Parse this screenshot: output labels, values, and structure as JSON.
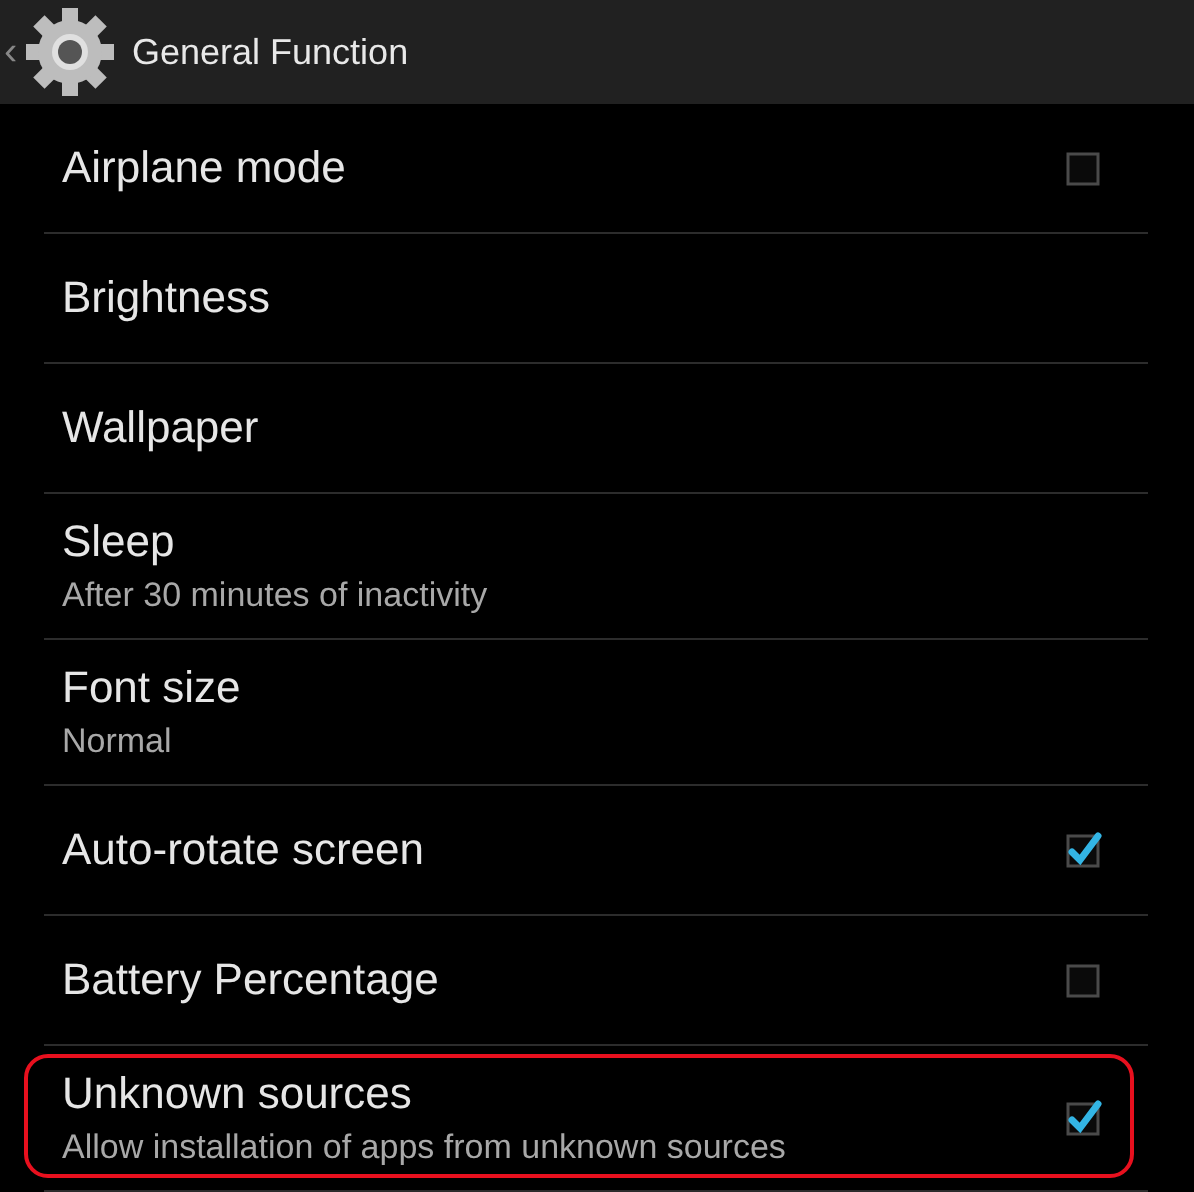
{
  "header": {
    "back": "‹",
    "title": "General Function"
  },
  "settings": [
    {
      "title": "Airplane mode",
      "kind": "checkbox",
      "checked": false,
      "highlighted": false
    },
    {
      "title": "Brightness",
      "kind": "plain",
      "highlighted": false
    },
    {
      "title": "Wallpaper",
      "kind": "plain",
      "highlighted": false
    },
    {
      "title": "Sleep",
      "summary": "After 30 minutes of inactivity",
      "kind": "plain",
      "highlighted": false
    },
    {
      "title": "Font size",
      "summary": "Normal",
      "kind": "plain",
      "highlighted": false
    },
    {
      "title": "Auto-rotate screen",
      "kind": "checkbox",
      "checked": true,
      "highlighted": false
    },
    {
      "title": "Battery Percentage",
      "kind": "checkbox",
      "checked": false,
      "highlighted": false
    },
    {
      "title": "Unknown sources",
      "summary": "Allow installation of apps from unknown sources",
      "kind": "checkbox",
      "checked": true,
      "highlighted": true
    }
  ]
}
